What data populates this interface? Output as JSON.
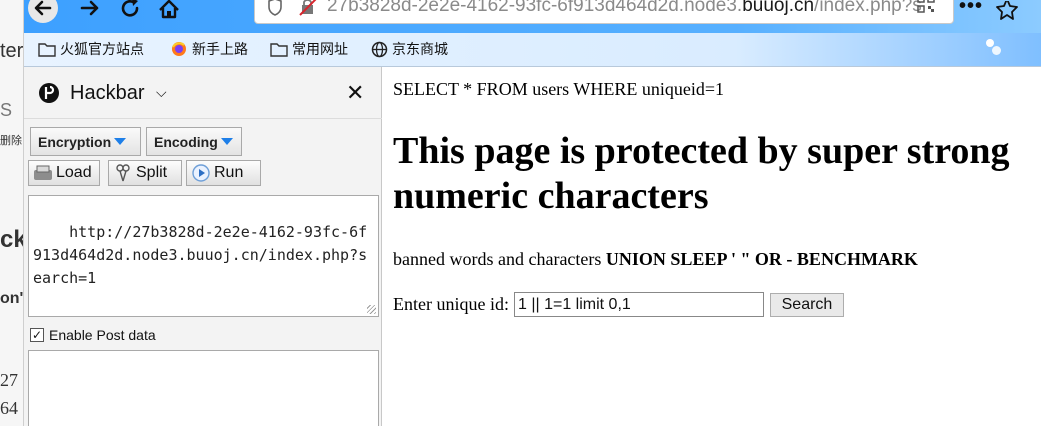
{
  "background_window": {
    "fragments": [
      "ter",
      "删除",
      "ckb",
      "on'",
      "27",
      "64"
    ]
  },
  "browser": {
    "url_prefix": "27b3828d-2e2e-4162-93fc-6f913d464d2d.node3.",
    "url_domain": "buuoj.cn",
    "url_path": "/index.php?s"
  },
  "bookmarks": [
    {
      "label": "火狐官方站点",
      "icon": "folder-icon"
    },
    {
      "label": "新手上路",
      "icon": "firefox-icon"
    },
    {
      "label": "常用网址",
      "icon": "folder-icon"
    },
    {
      "label": "京东商城",
      "icon": "globe-icon"
    }
  ],
  "hackbar": {
    "title": "Hackbar",
    "encryption_label": "Encryption",
    "encoding_label": "Encoding",
    "load_label": "Load",
    "split_label": "Split",
    "run_label": "Run",
    "url_value": "http://27b3828d-2e2e-4162-93fc-6f913d464d2d.node3.buuoj.cn/index.php?search=1",
    "enable_post_label": "Enable Post data",
    "enable_post_checked": true,
    "post_value": ""
  },
  "page": {
    "sql_query": "SELECT * FROM users WHERE uniqueid=1",
    "heading": "This page is protected by super strong numeric characters",
    "banned_prefix": "banned words and characters ",
    "banned_list": "UNION SLEEP ' \" OR - BENCHMARK",
    "form_label": "Enter unique id:",
    "input_value": "1 || 1=1 limit 0,1",
    "search_button": "Search"
  },
  "colors": {
    "toolbar": "#45a1ff",
    "bookmarks_bar": "#e6f2ff",
    "hackbar_bg": "#f3f3f3",
    "dropdown_arrow": "#1e7fe8"
  }
}
